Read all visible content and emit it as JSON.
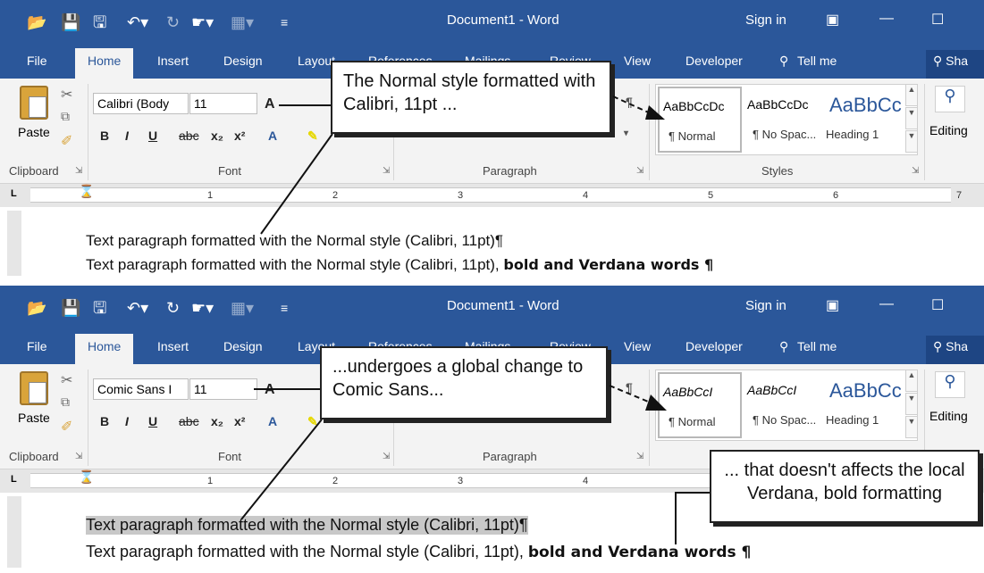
{
  "colors": {
    "accent": "#2b579a",
    "ribbon": "#f3f3f3",
    "highlight": "#c8c8c8"
  },
  "window": {
    "title": "Document1  -  Word",
    "signin": "Sign in",
    "share": "Sha"
  },
  "tabs": [
    "File",
    "Home",
    "Insert",
    "Design",
    "Layout",
    "References",
    "Mailings",
    "Review",
    "View",
    "Developer",
    "Tell me"
  ],
  "groups": {
    "clipboard": "Clipboard",
    "font": "Font",
    "paragraph": "Paragraph",
    "styles": "Styles",
    "editing": "Editing",
    "paste": "Paste"
  },
  "font_size": "11",
  "styles": [
    {
      "preview": "AaBbCcDc",
      "name": "¶ Normal"
    },
    {
      "preview": "AaBbCcDc",
      "name": "¶ No Spac..."
    },
    {
      "preview": "AaBbCc",
      "name": "Heading 1"
    }
  ],
  "ruler_numbers": [
    "1",
    "2",
    "3",
    "4",
    "5",
    "6",
    "7"
  ],
  "panelA": {
    "font_box": "Calibri (Body",
    "para1": "Text paragraph formatted with the Normal style (Calibri, 11pt)¶",
    "para2_prefix": "Text paragraph formatted with the Normal style (Calibri, 11pt), ",
    "para2_bold": "bold and Verdana words ¶",
    "callout": "The Normal style formatted with Calibri, 11pt ..."
  },
  "panelB": {
    "font_box": "Comic Sans I",
    "style_preview": "AaBbCcI",
    "para1": "Text paragraph formatted with the Normal style (Calibri, 11pt)¶",
    "para2_prefix": "Text paragraph formatted with the Normal style (Calibri, 11pt), ",
    "para2_bold": "bold and Verdana words ¶",
    "callout1": "...undergoes a global change to Comic Sans...",
    "callout2": "... that doesn't affects the local Verdana, bold formatting"
  },
  "icons": [
    "folder-icon",
    "save-icon",
    "save-as-icon",
    "undo-icon",
    "redo-icon",
    "touch-mode-icon",
    "customize-icon",
    "cut-icon",
    "copy-icon",
    "format-painter-icon",
    "search-icon",
    "user-icon",
    "ribbon-options-icon",
    "minimize-icon",
    "maximize-icon",
    "pilcrow-icon",
    "lightbulb-icon"
  ]
}
